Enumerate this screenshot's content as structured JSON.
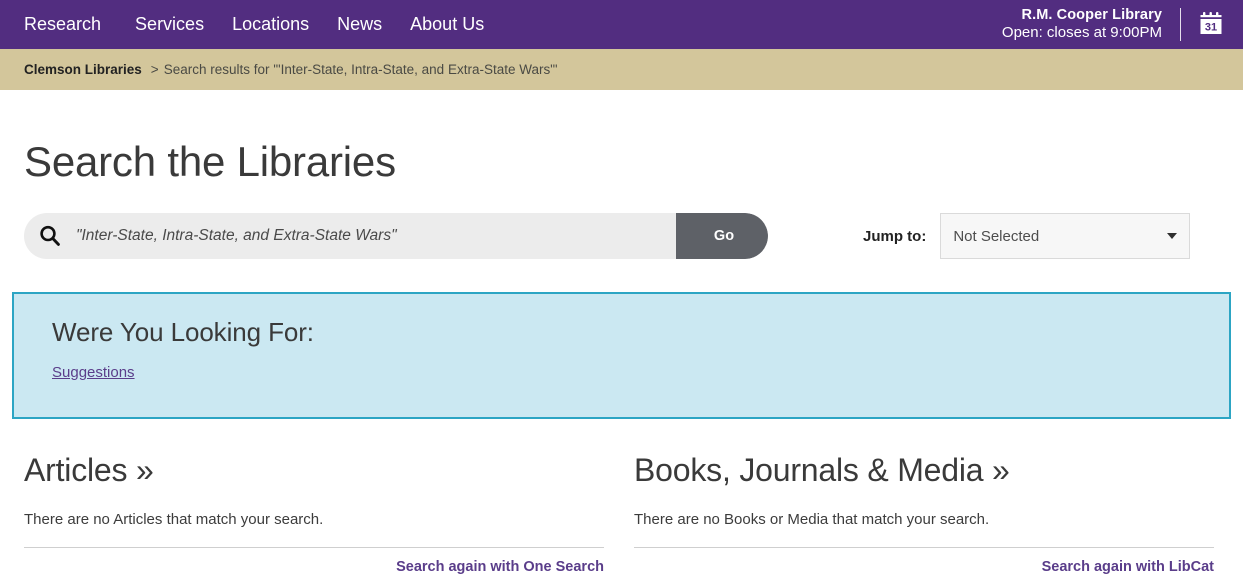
{
  "topbar": {
    "nav": [
      {
        "label": "Research"
      },
      {
        "label": "Services"
      },
      {
        "label": "Locations"
      },
      {
        "label": "News"
      },
      {
        "label": "About Us"
      }
    ],
    "library_name": "R.M. Cooper Library",
    "library_hours": "Open: closes at 9:00PM",
    "calendar_icon_day": "31",
    "background_color": "#522D80"
  },
  "breadcrumb": {
    "home_label": "Clemson Libraries",
    "separator": ">",
    "current": "Search results for '\"Inter-State, Intra-State, and Extra-State Wars\"'",
    "background_color": "#D3C69B"
  },
  "page": {
    "title": "Search the Libraries"
  },
  "search": {
    "value": "\"Inter-State, Intra-State, and Extra-State Wars\"",
    "placeholder": "\"Inter-State, Intra-State, and Extra-State Wars\"",
    "go_label": "Go",
    "go_color": "#5e6167"
  },
  "jump_to": {
    "label": "Jump to:",
    "selected": "Not Selected",
    "options": [
      "Not Selected"
    ]
  },
  "suggestions_panel": {
    "title": "Were You Looking For:",
    "link_label": "Suggestions",
    "background_color": "#CBE8F2",
    "border_color": "#2CA5C4"
  },
  "results": [
    {
      "heading": "Articles »",
      "message": "There are no Articles that match your search.",
      "action_label": "Search again with One Search"
    },
    {
      "heading": "Books, Journals & Media »",
      "message": "There are no Books or Media that match your search.",
      "action_label": "Search again with LibCat"
    }
  ],
  "colors": {
    "brand_purple": "#522D80",
    "link_purple": "#5a3d8a",
    "tan": "#D3C69B"
  }
}
